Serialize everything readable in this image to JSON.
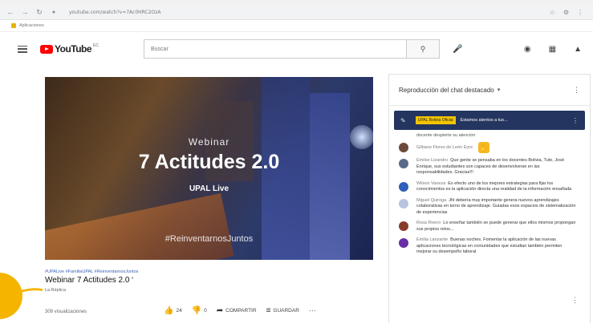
{
  "browser": {
    "url": "youtube.com/watch?v=7Ac0HRC2OzA",
    "bookmark_label": "Aplicaciones"
  },
  "header": {
    "logo_text": "YouTube",
    "logo_sup": "EC",
    "search_placeholder": "Buscar"
  },
  "video": {
    "overlay": {
      "subtitle": "Webinar",
      "title": "7 Actitudes 2.0",
      "presenter": "UPAL Live",
      "hashtag": "#ReinventarnosJuntos"
    },
    "hashtags": "#UPALive #FamiliaUPAL #ReinventarnosJuntos",
    "title": "Webinar 7 Actitudes 2.0",
    "channel": "La Réplica",
    "views": "309 visualizaciones",
    "likes": "24",
    "dislikes": "0",
    "share_label": "COMPARTIR",
    "save_label": "GUARDAR"
  },
  "chat": {
    "header_title": "Reproducción del chat destacado",
    "pinned": {
      "author": "UPAL Bolivia Oficial",
      "text": "Estamos atentos a tus..."
    },
    "continuation": "docente despierte su atención",
    "messages": [
      {
        "author": "Gilbano Flores de León Eyre",
        "text": "",
        "avatar_color": "#6b4a3a",
        "emoji": true
      },
      {
        "author": "Emilse Lizandro",
        "text": "Que gente se pensaba en los docentes Bolivia, Tuto, José Enrique, sus estudiantes son capaces de desenvolverse en las responsabilidades. Gracias!!!",
        "avatar_color": "#5a6b8a"
      },
      {
        "author": "Wilson Vaneza",
        "text": "Es efecto uno de los mejores estrategias para fijar los conocimientos es la aplicación directa una realidad de la información ensañada",
        "avatar_color": "#2f5fb8"
      },
      {
        "author": "Miguel Quiroga",
        "text": "Jhl debería muy importante genera nuevos aprendizajes colaborativas en torno de aprendizaje. Guiadas esos espacios de sistematización de experiencias",
        "avatar_color": "#b8c4e0"
      },
      {
        "author": "Rosa Rivero",
        "text": "Lo enseñar también se puede generar que ellos mismos propongan sus propios retos...",
        "avatar_color": "#8a3a2a"
      },
      {
        "author": "Emilia Lanzante",
        "text": "Buenas noches. Fomentar la aplicación de las nuevas aplicaciones tecnológicas en comunidades que estudian también permiten mejorar su desempeño laboral",
        "avatar_color": "#6a2fa8"
      }
    ]
  },
  "colors": {
    "youtube_red": "#ff0000",
    "pinned_bg": "#24355f",
    "pinned_author_bg": "#f2c400",
    "link_blue": "#3d63b8"
  },
  "icons": [
    "back-icon",
    "forward-icon",
    "reload-icon",
    "menu-icon",
    "search-icon",
    "mic-icon",
    "create-icon",
    "apps-icon",
    "notifications-icon",
    "pin-icon",
    "thumb-up-icon",
    "thumb-down-icon",
    "share-icon",
    "save-icon",
    "more-icon"
  ]
}
